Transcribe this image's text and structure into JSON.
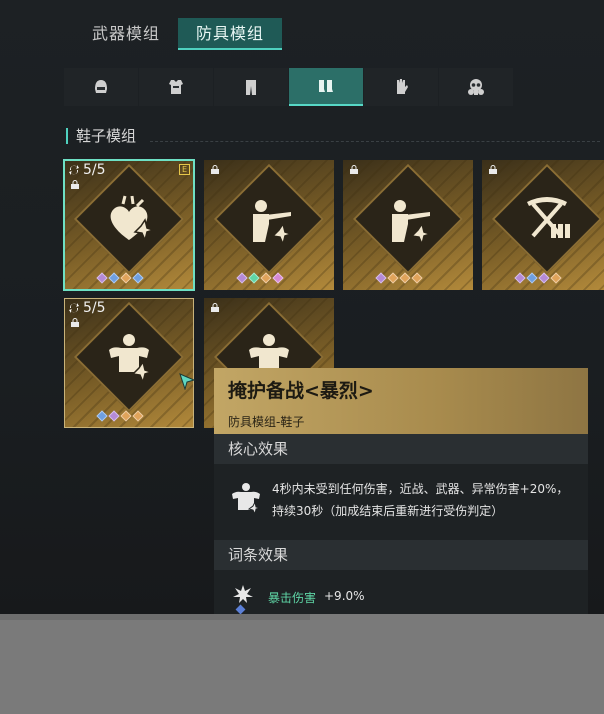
{
  "top_tabs": [
    {
      "label": "武器模组",
      "active": false
    },
    {
      "label": "防具模组",
      "active": true
    }
  ],
  "categories": [
    {
      "icon": "helmet-icon",
      "active": false
    },
    {
      "icon": "armor-vest-icon",
      "active": false
    },
    {
      "icon": "pants-icon",
      "active": false
    },
    {
      "icon": "boots-icon",
      "active": true
    },
    {
      "icon": "gloves-icon",
      "active": false
    },
    {
      "icon": "gas-mask-icon",
      "active": false
    }
  ],
  "section_title": "鞋子模组",
  "cards": [
    {
      "emblem": "heart-icon",
      "count": "5/5",
      "locked": true,
      "badge": "E",
      "selected": true,
      "gems": [
        "#b58ad6",
        "#6f9fe0",
        "#e0a35a",
        "#6f9fe0"
      ]
    },
    {
      "emblem": "rifle-aim-icon",
      "count": "",
      "locked": true,
      "badge": "",
      "selected": false,
      "gems": [
        "#b58ad6",
        "#5fd6a6",
        "#e0a35a",
        "#d68ad6"
      ]
    },
    {
      "emblem": "rifle-aim-icon",
      "count": "",
      "locked": true,
      "badge": "",
      "selected": false,
      "gems": [
        "#b58ad6",
        "#e0a35a",
        "#e0a35a",
        "#e0a35a"
      ]
    },
    {
      "emblem": "crossed-picks-ammo-icon",
      "count": "",
      "locked": true,
      "badge": "",
      "selected": false,
      "gems": [
        "#b58ad6",
        "#6f9fe0",
        "#b58ad6",
        "#e0a35a"
      ]
    },
    {
      "emblem": "muscle-body-icon",
      "count": "5/5",
      "locked": true,
      "badge": "",
      "selected": false,
      "gems": [
        "#6f9fe0",
        "#b58ad6",
        "#e0a35a",
        "#e0a35a"
      ]
    },
    {
      "emblem": "muscle-body-icon",
      "count": "",
      "locked": true,
      "badge": "",
      "selected": false,
      "gems": []
    }
  ],
  "tooltip": {
    "title": "掩护备战<暴烈>",
    "subtitle": "防具模组-鞋子",
    "core_header": "核心效果",
    "core_text": "4秒内未受到任何伤害，近战、武器、异常伤害+20%，持续30秒（加成结束后重新进行受伤判定）",
    "affix_header": "词条效果",
    "affix_name": "暴击伤害",
    "affix_value": "+9.0%"
  },
  "colors": {
    "accent": "#4fd1bf",
    "card_gold": "#b38a3b",
    "tooltip_gold": "#c2a665",
    "affix_green": "#5fd6a6"
  }
}
